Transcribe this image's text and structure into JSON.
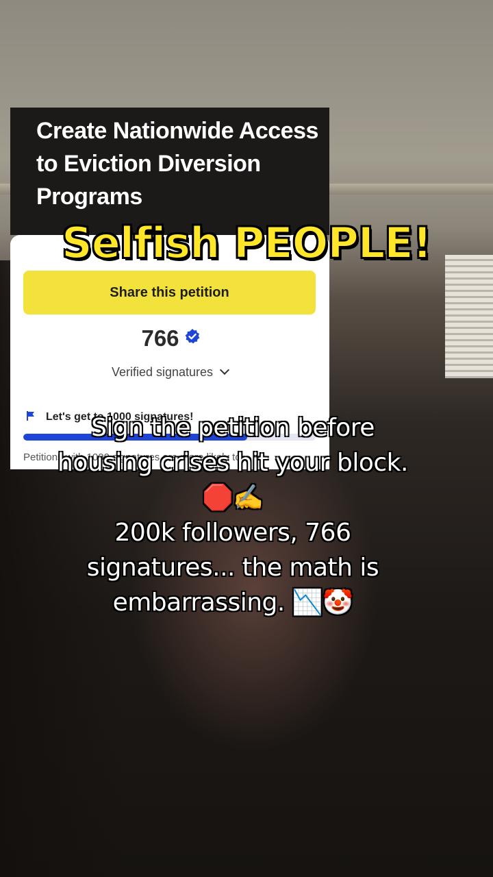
{
  "petition": {
    "title": "Create Nationwide Access to Eviction Diversion Programs",
    "share_label": "Share this petition",
    "signature_count": "766",
    "verified_label": "Verified signatures",
    "goal_text": "Let's get to 1000 signatures!",
    "progress_fraction": 0.766,
    "note_text": "Petitions with 1000 signatures are more likely to..."
  },
  "overlay": {
    "headline": "Selfish PEOPLE!",
    "caption": "Sign the petition before housing crises hit your block. 🛑✍️\n200k followers, 766 signatures... the math is embarrassing. 📉🤡"
  },
  "colors": {
    "share_button": "#f3e13c",
    "progress": "#1f45d6",
    "verified_badge": "#1f45d6",
    "headline": "#ffe629"
  },
  "icons": [
    "verified-check-icon",
    "chevron-down-icon",
    "flag-icon"
  ]
}
